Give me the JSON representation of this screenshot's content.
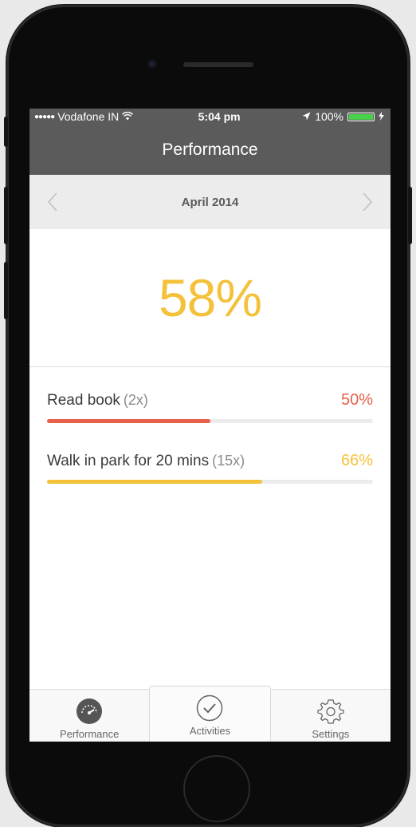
{
  "status_bar": {
    "carrier": "Vodafone IN",
    "time": "5:04 pm",
    "battery": "100%"
  },
  "header": {
    "title": "Performance"
  },
  "month_nav": {
    "label": "April 2014"
  },
  "summary": {
    "percent": "58%"
  },
  "activities": [
    {
      "name": "Read book",
      "count": "(2x)",
      "percent": "50%",
      "progress": 0.5,
      "color": "#e8604c"
    },
    {
      "name": "Walk in park for 20 mins",
      "count": "(15x)",
      "percent": "66%",
      "progress": 0.66,
      "color": "#f4c13b"
    }
  ],
  "tabs": [
    {
      "label": "Performance",
      "icon": "speedometer-icon"
    },
    {
      "label": "Activities",
      "icon": "checkmark-circle-icon"
    },
    {
      "label": "Settings",
      "icon": "gear-icon"
    }
  ],
  "colors": {
    "header_bg": "#5b5b5c",
    "accent_yellow": "#f4c13b",
    "accent_red": "#e8604c"
  }
}
